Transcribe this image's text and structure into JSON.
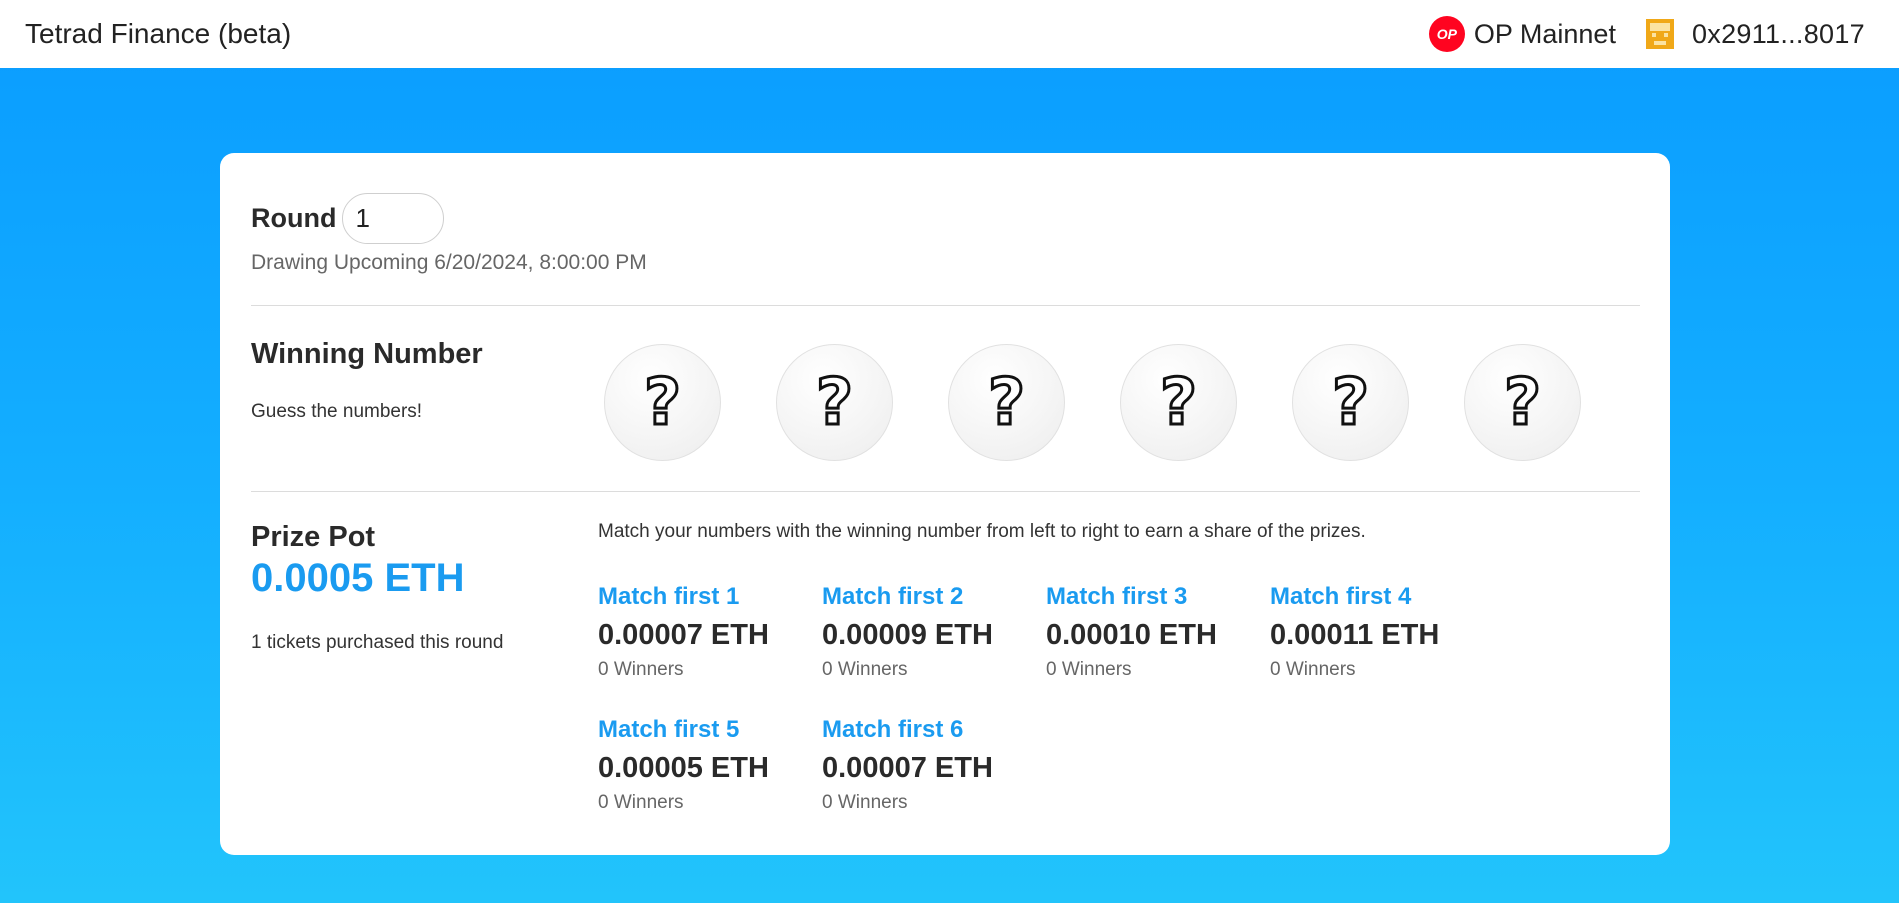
{
  "header": {
    "app_title": "Tetrad Finance (beta)",
    "network": {
      "badge_text": "OP",
      "label": "OP Mainnet",
      "badge_color": "#ff0420"
    },
    "account": {
      "address": "0x2911...8017",
      "avatar_color": "#f0a818"
    }
  },
  "round": {
    "label": "Round",
    "value": "1",
    "drawing_info": "Drawing Upcoming 6/20/2024, 8:00:00 PM"
  },
  "winning": {
    "title": "Winning Number",
    "subtitle": "Guess the numbers!",
    "balls": [
      "?",
      "?",
      "?",
      "?",
      "?",
      "?"
    ]
  },
  "prize": {
    "title": "Prize Pot",
    "amount": "0.0005 ETH",
    "tickets_text": "1 tickets purchased this round",
    "description": "Match your numbers with the winning number from left to right to earn a share of the prizes.",
    "matches": [
      {
        "title": "Match first 1",
        "amount": "0.00007 ETH",
        "winners": "0 Winners"
      },
      {
        "title": "Match first 2",
        "amount": "0.00009 ETH",
        "winners": "0 Winners"
      },
      {
        "title": "Match first 3",
        "amount": "0.00010 ETH",
        "winners": "0 Winners"
      },
      {
        "title": "Match first 4",
        "amount": "0.00011 ETH",
        "winners": "0 Winners"
      },
      {
        "title": "Match first 5",
        "amount": "0.00005 ETH",
        "winners": "0 Winners"
      },
      {
        "title": "Match first 6",
        "amount": "0.00007 ETH",
        "winners": "0 Winners"
      }
    ]
  },
  "colors": {
    "accent": "#1a9bf0",
    "background_top": "#0a9cff",
    "background_bottom": "#22c4fb"
  }
}
